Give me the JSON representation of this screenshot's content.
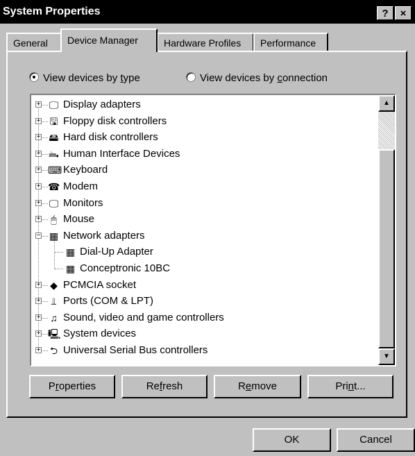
{
  "window": {
    "title": "System Properties",
    "help_label": "?",
    "close_label": "×"
  },
  "tabs": [
    {
      "label": "General",
      "active": false
    },
    {
      "label": "Device Manager",
      "active": true
    },
    {
      "label": "Hardware Profiles",
      "active": false
    },
    {
      "label": "Performance",
      "active": false
    }
  ],
  "view_options": {
    "by_type": {
      "prefix": "View devices by ",
      "accel": "t",
      "suffix": "ype",
      "selected": true
    },
    "by_connection": {
      "prefix": "View devices by ",
      "accel": "c",
      "suffix": "onnection",
      "selected": false
    }
  },
  "devices": [
    {
      "label": "Display adapters",
      "icon": "display-icon",
      "expanded": false
    },
    {
      "label": "Floppy disk controllers",
      "icon": "floppy-controller-icon",
      "expanded": false
    },
    {
      "label": "Hard disk controllers",
      "icon": "hard-disk-controller-icon",
      "expanded": false
    },
    {
      "label": "Human Interface Devices",
      "icon": "hid-icon",
      "expanded": false
    },
    {
      "label": "Keyboard",
      "icon": "keyboard-icon",
      "expanded": false
    },
    {
      "label": "Modem",
      "icon": "modem-icon",
      "expanded": false
    },
    {
      "label": "Monitors",
      "icon": "monitor-icon",
      "expanded": false
    },
    {
      "label": "Mouse",
      "icon": "mouse-icon",
      "expanded": false
    },
    {
      "label": "Network adapters",
      "icon": "network-adapter-icon",
      "expanded": true,
      "children": [
        {
          "label": "Dial-Up Adapter",
          "icon": "network-card-icon"
        },
        {
          "label": "Conceptronic 10BC",
          "icon": "network-card-icon"
        }
      ]
    },
    {
      "label": "PCMCIA socket",
      "icon": "pcmcia-icon",
      "expanded": false
    },
    {
      "label": "Ports (COM & LPT)",
      "icon": "port-icon",
      "expanded": false
    },
    {
      "label": "Sound, video and game controllers",
      "icon": "sound-icon",
      "expanded": false
    },
    {
      "label": "System devices",
      "icon": "system-device-icon",
      "expanded": false
    },
    {
      "label": "Universal Serial Bus controllers",
      "icon": "usb-icon",
      "expanded": false
    }
  ],
  "expander": {
    "plus": "+",
    "minus": "−"
  },
  "action_buttons": {
    "properties": {
      "pre": "P",
      "accel": "r",
      "post": "operties"
    },
    "refresh": {
      "pre": "Re",
      "accel": "f",
      "post": "resh"
    },
    "remove": {
      "pre": "R",
      "accel": "e",
      "post": "move"
    },
    "print": {
      "pre": "Pri",
      "accel": "n",
      "post": "t..."
    }
  },
  "dialog_buttons": {
    "ok": "OK",
    "cancel": "Cancel"
  }
}
